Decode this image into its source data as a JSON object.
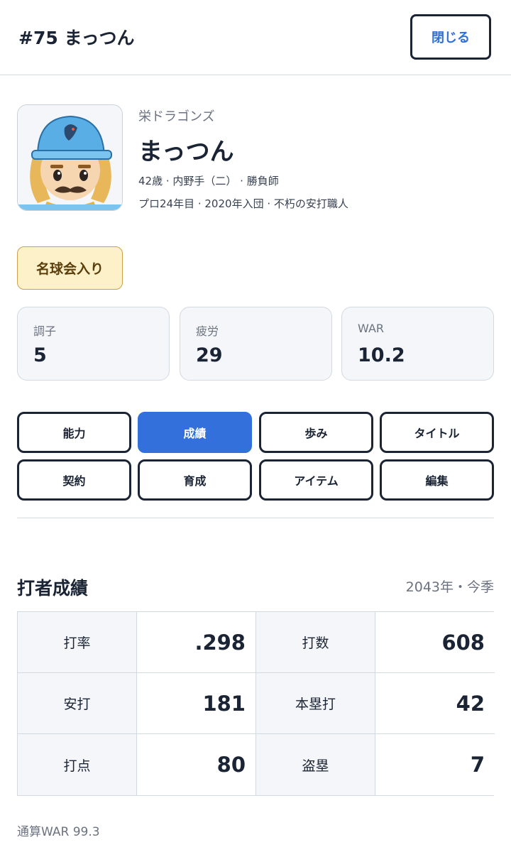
{
  "header": {
    "title": "#75 まっつん",
    "close_label": "閉じる"
  },
  "player": {
    "team": "栄ドラゴンズ",
    "name": "まっつん",
    "meta_line1": "42歳 · 内野手（二） · 勝負師",
    "meta_line2": "プロ24年目 · 2020年入団 · 不朽の安打職人",
    "avatar_icon": "player-avatar-icon"
  },
  "badge": {
    "label": "名球会入り"
  },
  "stat_cards": [
    {
      "label": "調子",
      "value": "5"
    },
    {
      "label": "疲労",
      "value": "29"
    },
    {
      "label": "WAR",
      "value": "10.2"
    }
  ],
  "tabs": [
    {
      "label": "能力",
      "active": false
    },
    {
      "label": "成績",
      "active": true
    },
    {
      "label": "歩み",
      "active": false
    },
    {
      "label": "タイトル",
      "active": false
    },
    {
      "label": "契約",
      "active": false
    },
    {
      "label": "育成",
      "active": false
    },
    {
      "label": "アイテム",
      "active": false
    },
    {
      "label": "編集",
      "active": false
    }
  ],
  "batting": {
    "title": "打者成績",
    "season": "2043年・今季",
    "rows": [
      [
        {
          "key": "打率",
          "value": ".298"
        },
        {
          "key": "打数",
          "value": "608"
        }
      ],
      [
        {
          "key": "安打",
          "value": "181"
        },
        {
          "key": "本塁打",
          "value": "42"
        }
      ],
      [
        {
          "key": "打点",
          "value": "80"
        },
        {
          "key": "盗塁",
          "value": "7"
        }
      ]
    ],
    "career": "通算WAR 99.3"
  },
  "colors": {
    "accent": "#3470dc",
    "text": "#1b2434",
    "muted": "#6b7280",
    "badge_bg": "#fdf1c9",
    "card_bg": "#f4f6f9"
  }
}
